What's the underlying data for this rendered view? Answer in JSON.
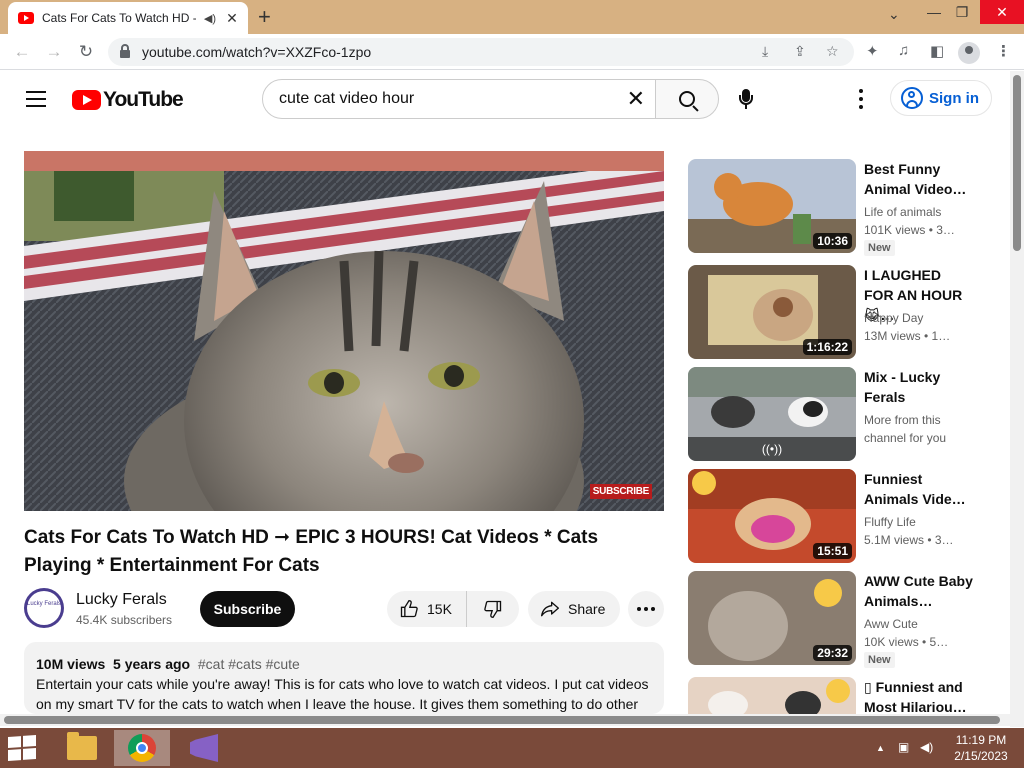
{
  "browser": {
    "tab_title": "Cats For Cats To Watch HD -",
    "tab_audio_icon": "speaker-icon",
    "tab_close": "✕",
    "new_tab": "+",
    "url": "youtube.com/watch?v=XXZFco-1zpo",
    "controls": {
      "minimize": "—",
      "restore": "❐",
      "close": "✕",
      "tab_search": "⌄"
    }
  },
  "yt": {
    "logo_text": "YouTube",
    "search": {
      "value": "cute cat video hour",
      "clear": "✕"
    },
    "sign_in": "Sign in"
  },
  "video": {
    "title": "Cats For Cats To Watch HD ➞ EPIC 3 HOURS! Cat Videos * Cats Playing * Entertainment For Cats",
    "watermark": "SUBSCRIBE",
    "channel": {
      "name": "Lucky Ferals",
      "subscribers": "45.4K subscribers",
      "avatar_text": "Lucky Ferals"
    },
    "subscribe_label": "Subscribe",
    "likes": "15K",
    "share_label": "Share",
    "description": {
      "views": "10M views",
      "age": "5 years ago",
      "tags": "#cat #cats #cute",
      "text": "Entertain your cats while you're away! This is for cats who love to watch cat videos. I put cat videos on my smart TV for the cats to watch when I leave the house. It gives them something to do other"
    }
  },
  "recommendations": [
    {
      "title": "Best Funny Animal Video…",
      "channel": "Life of animals",
      "views": "101K views  • 3…",
      "duration": "10:36",
      "badge": "New"
    },
    {
      "title": "I LAUGHED FOR AN HOUR😹…",
      "channel": "Happy Day",
      "views": "13M views  • 1…",
      "duration": "1:16:22",
      "badge": ""
    },
    {
      "title": "Mix - Lucky Ferals",
      "channel": "More from this",
      "views": "channel for you",
      "duration": "",
      "badge": "",
      "mix_icon": "((•))"
    },
    {
      "title": "Funniest Animals Vide…",
      "channel": "Fluffy Life",
      "views": "5.1M views  • 3…",
      "duration": "15:51",
      "badge": ""
    },
    {
      "title": "AWW Cute Baby Animals…",
      "channel": "Aww Cute",
      "views": "10K views  • 5…",
      "duration": "29:32",
      "badge": "New"
    },
    {
      "title": "▯ Funniest and Most Hilariou…",
      "channel": "",
      "views": "",
      "duration": "",
      "badge": ""
    }
  ],
  "taskbar": {
    "time": "11:19 PM",
    "date": "2/15/2023",
    "tray_arrow": "▲"
  },
  "colors": {
    "titlebar": "#d7b182",
    "taskbar": "#7a4a3a",
    "yt_red": "#ff0000",
    "link_blue": "#065fd4"
  }
}
